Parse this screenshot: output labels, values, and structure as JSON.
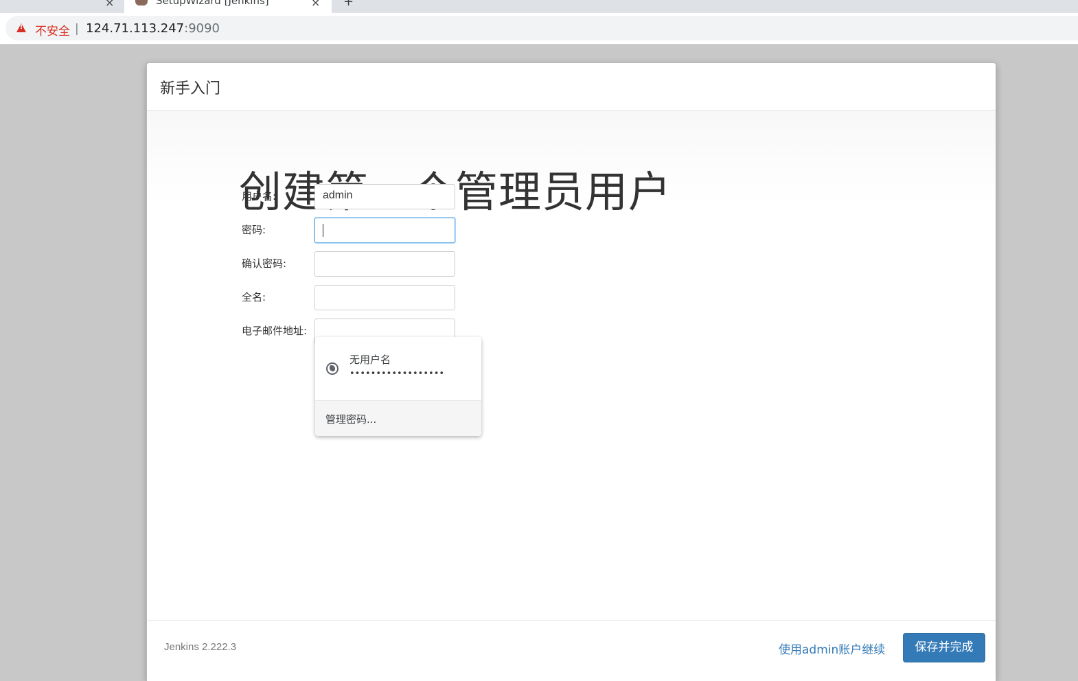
{
  "browser": {
    "active_tab_title": "SetupWizard [Jenkins]",
    "tab_close_symbol": "×",
    "new_tab_symbol": "+",
    "security_label": "不安全",
    "separator": "|",
    "url_host": "124.71.113.247",
    "url_port": ":9090",
    "warning_color": "#d93025"
  },
  "dialog": {
    "title": "新手入门",
    "heading": "创建第一个管理员用户",
    "fields": [
      {
        "label": "用户名:",
        "value": "admin"
      },
      {
        "label": "密码:",
        "value": ""
      },
      {
        "label": "确认密码:",
        "value": ""
      },
      {
        "label": "全名:",
        "value": ""
      },
      {
        "label": "电子邮件地址:",
        "value": ""
      }
    ]
  },
  "password_popup": {
    "username": "无用户名",
    "password_mask": "••••••••••••••••••",
    "manage_label": "管理密码..."
  },
  "footer": {
    "version": "Jenkins 2.222.3",
    "continue_link": "使用admin账户继续",
    "save_button": "保存并完成",
    "accent_color": "#337ab7"
  }
}
